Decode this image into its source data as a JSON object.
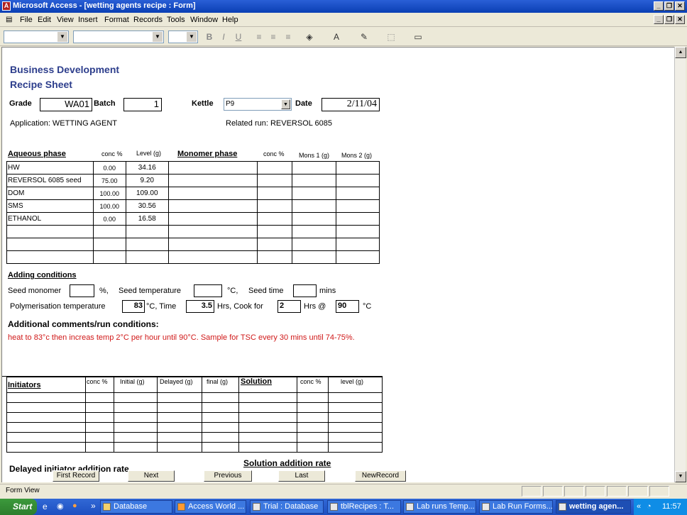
{
  "window": {
    "title": "Microsoft Access - [wetting agents recipe : Form]"
  },
  "menu": [
    "File",
    "Edit",
    "View",
    "Insert",
    "Format",
    "Records",
    "Tools",
    "Window",
    "Help"
  ],
  "form": {
    "heading1": "Business Development",
    "heading2": "Recipe Sheet",
    "grade_label": "Grade",
    "grade_value": "WA01",
    "batch_label": "Batch",
    "batch_value": "1",
    "kettle_label": "Kettle",
    "kettle_value": "P9",
    "date_label": "Date",
    "date_value": "2/11/04",
    "application": "Application: WETTING AGENT",
    "related_run": "Related run:  REVERSOL 6085",
    "aqueous": {
      "title": "Aqueous phase",
      "col_conc": "conc %",
      "col_level": "Level (g)",
      "rows": [
        {
          "name": "HW",
          "conc": "0.00",
          "level": "34.16"
        },
        {
          "name": "REVERSOL 6085 seed",
          "conc": "75.00",
          "level": "9.20"
        },
        {
          "name": "DOM",
          "conc": "100.00",
          "level": "109.00"
        },
        {
          "name": "SMS",
          "conc": "100.00",
          "level": "30.56"
        },
        {
          "name": "ETHANOL",
          "conc": "0.00",
          "level": "16.58"
        },
        {
          "name": "",
          "conc": "",
          "level": ""
        },
        {
          "name": "",
          "conc": "",
          "level": ""
        },
        {
          "name": "",
          "conc": "",
          "level": ""
        }
      ]
    },
    "monomer": {
      "title": "Monomer phase",
      "col_conc": "conc %",
      "col_mons1": "Mons 1 (g)",
      "col_mons2": "Mons 2 (g)"
    },
    "adding": {
      "title": "Adding conditions",
      "seed_monomer": "Seed monomer",
      "pct": "%,",
      "seed_temp": "Seed temperature",
      "degc": "°C,",
      "seed_time": "Seed time",
      "mins": "mins",
      "poly_temp": "Polymerisation temperature",
      "poly_temp_value": "83",
      "time_label": "°C, Time",
      "time_value": "3.5",
      "cook_label": "Hrs,  Cook for",
      "cook_value": "2",
      "hrs_at": "Hrs @",
      "final_temp_value": "90",
      "final_unit": "°C"
    },
    "comments": {
      "title": "Additional comments/run conditions:",
      "text": "heat to 83°c then increas temp 2°C per hour until 90°C. Sample for TSC every 30 mins until 74-75%."
    },
    "initiators": {
      "title": "Initiators",
      "col_conc": "conc %",
      "col_initial": "Initial (g)",
      "col_delayed": "Delayed (g)",
      "col_final": "final (g)"
    },
    "solution": {
      "title": "Solution",
      "col_conc": "conc %",
      "col_level": "level  (g)"
    },
    "delayed_rate": "Delayed initiator addition rate",
    "solution_rate": "Solution addition rate"
  },
  "nav": {
    "first": "First Record",
    "next": "Next",
    "previous": "Previous",
    "last": "Last",
    "new": "NewRecord"
  },
  "status": "Form View",
  "taskbar": {
    "start": "Start",
    "items": [
      "Database",
      "Access World ...",
      "Trial : Database",
      "tblRecipes : T...",
      "Lab runs Temp...",
      "Lab Run Forms...",
      "wetting agen..."
    ],
    "time": "11:57"
  }
}
